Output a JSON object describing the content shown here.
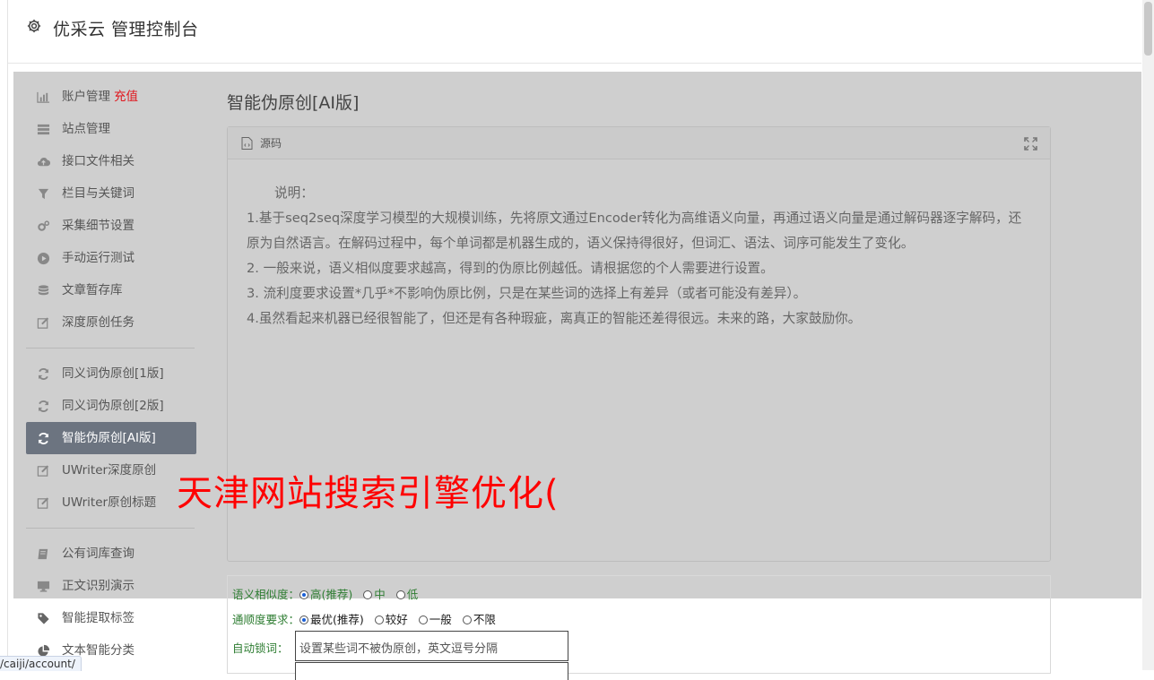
{
  "header": {
    "title": "优采云 管理控制台"
  },
  "sidebar": {
    "items": [
      {
        "label": "账户管理",
        "extra": "充值",
        "icon": "bar-chart-icon"
      },
      {
        "label": "站点管理",
        "icon": "server-icon"
      },
      {
        "label": "接口文件相关",
        "icon": "cloud-upload-icon"
      },
      {
        "label": "栏目与关键词",
        "icon": "filter-icon"
      },
      {
        "label": "采集细节设置",
        "icon": "gears-icon"
      },
      {
        "label": "手动运行测试",
        "icon": "play-circle-icon"
      },
      {
        "label": "文章暂存库",
        "icon": "database-icon"
      },
      {
        "label": "深度原创任务",
        "icon": "edit-icon"
      }
    ],
    "items2": [
      {
        "label": "同义词伪原创[1版]",
        "icon": "refresh-icon"
      },
      {
        "label": "同义词伪原创[2版]",
        "icon": "refresh-icon"
      },
      {
        "label": "智能伪原创[AI版]",
        "icon": "refresh-icon",
        "active": true
      },
      {
        "label": "UWriter深度原创",
        "icon": "edit-icon"
      },
      {
        "label": "UWriter原创标题",
        "icon": "edit-icon"
      }
    ],
    "items3": [
      {
        "label": "公有词库查询",
        "icon": "book-icon"
      },
      {
        "label": "正文识别演示",
        "icon": "monitor-icon"
      },
      {
        "label": "智能提取标签",
        "icon": "tag-icon"
      },
      {
        "label": "文本智能分类",
        "icon": "pie-chart-icon"
      }
    ]
  },
  "main": {
    "title": "智能伪原创[AI版]",
    "panel": {
      "label": "源码",
      "intro": "说明：",
      "lines": [
        "1.基于seq2seq深度学习模型的大规模训练，先将原文通过Encoder转化为高维语义向量，再通过语义向量是通过解码器逐字解码，还原为自然语言。在解码过程中，每个单词都是机器生成的，语义保持得很好，但词汇、语法、词序可能发生了变化。",
        "2. 一般来说，语义相似度要求越高，得到的伪原比例越低。请根据您的个人需要进行设置。",
        "3. 流利度要求设置*几乎*不影响伪原比例，只是在某些词的选择上有差异（或者可能没有差异）。",
        "4.虽然看起来机器已经很智能了，但还是有各种瑕疵，离真正的智能还差得很远。未来的路，大家鼓励你。"
      ]
    },
    "form": {
      "similarity_label": "语义相似度：",
      "similarity_options": [
        "高(推荐)",
        "中",
        "低"
      ],
      "fluency_label": "通顺度要求：",
      "fluency_options": [
        "最优(推荐)",
        "较好",
        "一般",
        "不限"
      ],
      "lock_label": "自动锁词：",
      "lock_placeholder": "设置某些词不被伪原创，英文逗号分隔"
    }
  },
  "watermark": "天津网站搜索引擎优化(",
  "statusbar": {
    "url": "/caiji/account/"
  }
}
